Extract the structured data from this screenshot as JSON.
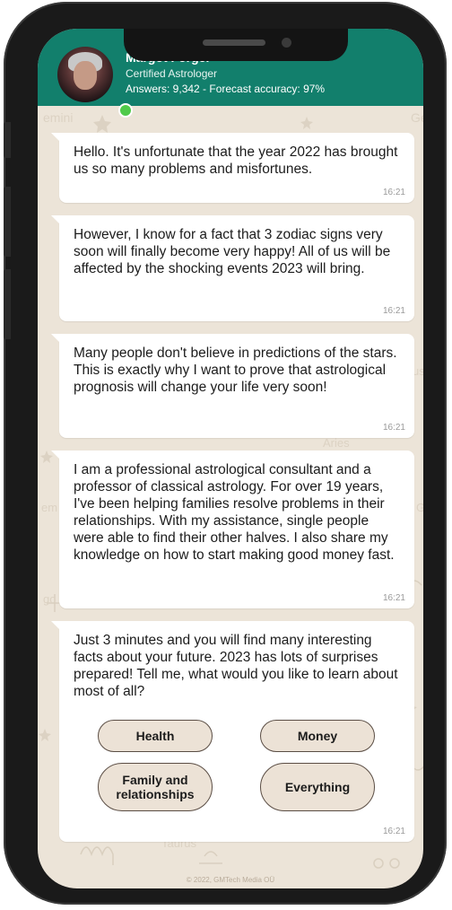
{
  "header": {
    "name": "Margot Forger",
    "role": "Certified Astrologer",
    "stats": "Answers: 9,342 - Forecast accuracy: 97%"
  },
  "messages": [
    {
      "text": "Hello. It's unfortunate that the year 2022 has brought us so many problems and misfortunes.",
      "time": "16:21"
    },
    {
      "text": "However, I know for a fact that 3 zodiac signs very soon will finally become very happy! All of us will be affected by the shocking events 2023 will bring.",
      "time": "16:21"
    },
    {
      "text": "Many people don't believe in predictions of the stars. This is exactly why I want to prove that astrological prognosis will change your life very soon!",
      "time": "16:21"
    },
    {
      "text": "I am a professional astrological consultant and a professor of classical astrology. For over 19 years, I've been helping families resolve problems in their relationships. With my assistance, single people were able to find their other halves. I also share my knowledge on how to start making good money fast.",
      "time": "16:21"
    },
    {
      "text": "Just 3 minutes and you will find many interesting facts about your future. 2023 has lots of surprises prepared! Tell me, what would you like to learn about most of all?",
      "time": "16:21"
    }
  ],
  "options": [
    "Health",
    "Money",
    "Family and relationships",
    "Everything"
  ],
  "footer": "© 2022, GMTech Media OÜ",
  "colors": {
    "header": "#127f6c",
    "chat_background": "#ece4d8",
    "online": "#4fca4a"
  }
}
